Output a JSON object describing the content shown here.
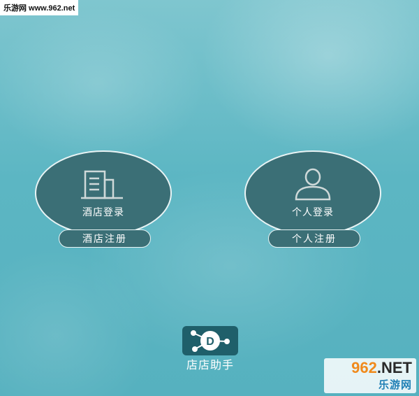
{
  "watermark_top": "乐游网 www.962.net",
  "buttons": {
    "hotel_login": "酒店登录",
    "personal_login": "个人登录",
    "hotel_register": "酒店注册",
    "personal_register": "个人注册"
  },
  "app": {
    "name": "店店助手",
    "logo_letter": "D"
  },
  "brand": {
    "number": "962",
    "domain": ".NET",
    "name": "乐游网"
  },
  "colors": {
    "button_fill": "#3b6f76",
    "button_border": "#e9f4f5",
    "background": "#5fb9c6",
    "logo_bg": "#1f5f6a"
  },
  "icons": {
    "hotel": "building-icon",
    "personal": "user-icon"
  }
}
